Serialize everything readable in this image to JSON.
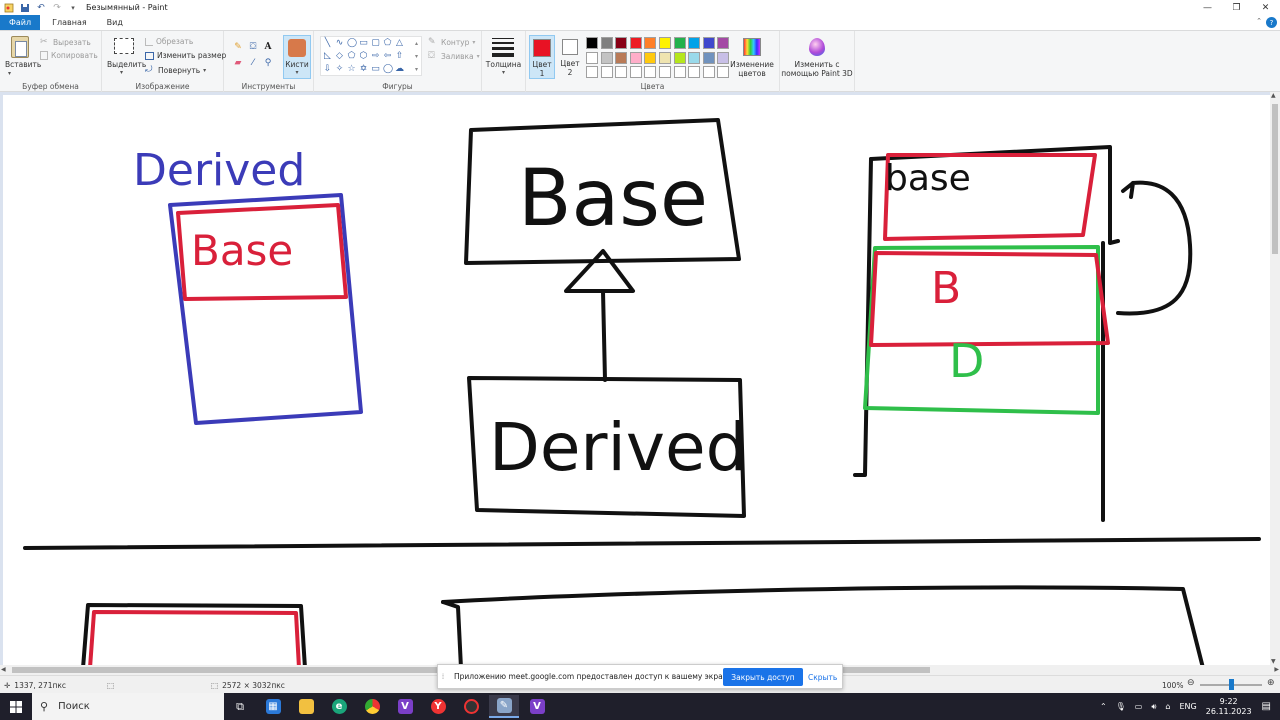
{
  "window": {
    "title": "Безымянный - Paint",
    "controls": [
      "minimize-icon",
      "restore-icon",
      "close-icon"
    ]
  },
  "tabs": [
    "Файл",
    "Главная",
    "Вид"
  ],
  "ribbon": {
    "clipboard": {
      "paste": "Вставить",
      "cut": "Вырезать",
      "copy": "Копировать",
      "group": "Буфер обмена"
    },
    "image": {
      "select": "Выделить",
      "crop": "Обрезать",
      "resize": "Изменить размер",
      "rotate": "Повернуть",
      "group": "Изображение"
    },
    "tools": {
      "brushes": "Кисти",
      "group": "Инструменты"
    },
    "shapes": {
      "outline": "Контур",
      "fill": "Заливка",
      "group": "Фигуры"
    },
    "thickness": "Толщина",
    "colors": {
      "color1": "Цвет",
      "color1_num": "1",
      "color2": "Цвет",
      "color2_num": "2",
      "edit": "Изменение",
      "edit2": "цветов",
      "group": "Цвета",
      "color1_value": "#e81224",
      "palette": [
        "#000000",
        "#7f7f7f",
        "#880015",
        "#ed1c24",
        "#ff7f27",
        "#fff200",
        "#22b14c",
        "#00a2e8",
        "#3f48cc",
        "#a349a4",
        "#ffffff",
        "#c3c3c3",
        "#b97a57",
        "#ffaec9",
        "#ffc90e",
        "#efe4b0",
        "#b5e61d",
        "#99d9ea",
        "#7092be",
        "#c8bfe7",
        "#ffffff",
        "#ffffff",
        "#ffffff",
        "#ffffff",
        "#ffffff",
        "#ffffff",
        "#ffffff",
        "#ffffff",
        "#ffffff",
        "#ffffff"
      ]
    },
    "paint3d": {
      "line1": "Изменить с",
      "line2": "помощью Paint 3D"
    }
  },
  "canvas": {
    "drawing_text": [
      "Derived",
      "Base",
      "Base",
      "Derived",
      "base",
      "B",
      "D"
    ],
    "colors": {
      "black": "#111111",
      "blue": "#3b3bb8",
      "red": "#d9203a",
      "green": "#2fbf4a"
    }
  },
  "status": {
    "cursor": "1337, 271пкс",
    "size": "2572 × 3032пкс",
    "zoom": "100%"
  },
  "share_banner": {
    "message": "Приложению meet.google.com предоставлен доступ к вашему экрану.",
    "stop": "Закрыть доступ",
    "hide": "Скрыть"
  },
  "taskbar": {
    "search": "Поиск",
    "lang": "ENG",
    "time": "9:22",
    "date": "26.11.2023"
  }
}
